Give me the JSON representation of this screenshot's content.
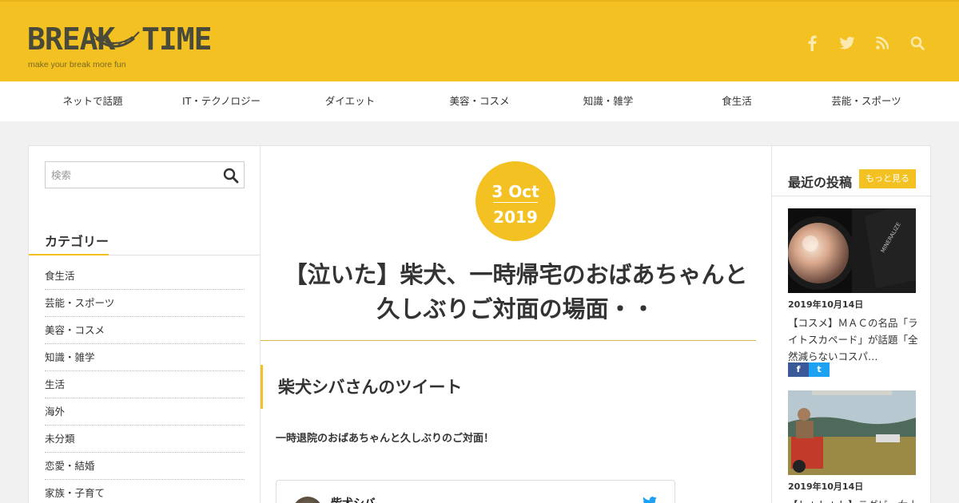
{
  "header": {
    "logo_left": "BREAK",
    "logo_right": "TIME",
    "tagline": "make your break more fun"
  },
  "nav": {
    "items": [
      "ネットで話題",
      "IT・テクノロジー",
      "ダイエット",
      "美容・コスメ",
      "知識・雑学",
      "食生活",
      "芸能・スポーツ"
    ]
  },
  "search": {
    "placeholder": "検索"
  },
  "categories": {
    "title": "カテゴリー",
    "items": [
      "食生活",
      "芸能・スポーツ",
      "美容・コスメ",
      "知識・雑学",
      "生活",
      "海外",
      "未分類",
      "恋愛・結婚",
      "家族・子育て"
    ]
  },
  "article": {
    "date_day": "3 Oct",
    "date_year": "2019",
    "title_line1": "【泣いた】柴犬、一時帰宅のおばあちゃんと",
    "title_line2": "久しぶりご対面の場面・・",
    "section_heading": "柴犬シバさんのツイート",
    "body_text": "一時退院のおばあちゃんと久しぶりのご対面！",
    "tweet_author": "柴犬シバ"
  },
  "recent": {
    "title": "最近の投稿",
    "more_label": "もっと見る",
    "posts": [
      {
        "date": "2019年10月14日",
        "title": "【コスメ】ＭＡＣの名品「ライトスカペード」が話題「全然減らないコスパ…"
      },
      {
        "date": "2019年10月14日",
        "title": "【ｈｔｈｔｈ】ラグビー女士"
      }
    ],
    "share_fb": "f",
    "share_tw": "t"
  },
  "colors": {
    "accent": "#f3c121",
    "facebook": "#3b5998",
    "twitter": "#1da1f2"
  }
}
